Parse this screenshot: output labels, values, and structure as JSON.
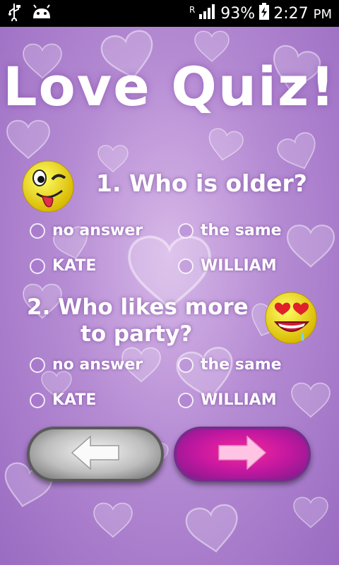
{
  "status_bar": {
    "icons": [
      "usb-icon",
      "android-debug-icon",
      "signal-icon",
      "battery-charging-icon"
    ],
    "roaming": "R",
    "battery": "93%",
    "time": "2:27",
    "ampm": "PM"
  },
  "title": "Love Quiz!",
  "questions": [
    {
      "text": "1. Who is older?",
      "emoji": "winking-tongue-emoji",
      "options": [
        "no answer",
        "the same",
        "KATE",
        "WILLIAM"
      ]
    },
    {
      "text_line1": "2. Who likes more",
      "text_line2": "to party?",
      "emoji": "heart-eyes-drooling-emoji",
      "options": [
        "no answer",
        "the same",
        "KATE",
        "WILLIAM"
      ]
    }
  ],
  "navigation": {
    "back_icon": "arrow-left-icon",
    "next_icon": "arrow-right-icon"
  },
  "colors": {
    "background": "#b58bd3",
    "next_button": "#d41b9c",
    "back_button": "#bdbdbd"
  }
}
